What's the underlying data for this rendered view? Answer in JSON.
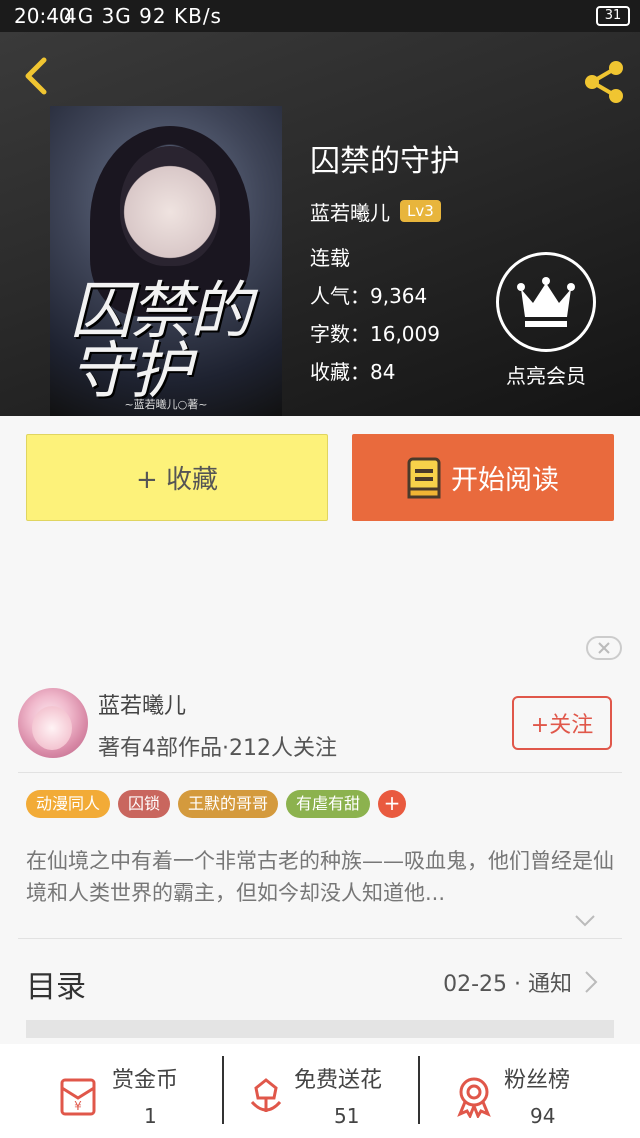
{
  "status_bar": {
    "time": "20:40",
    "network": "4G 3G",
    "speed": "92 KB/s",
    "battery": "31"
  },
  "book": {
    "title": "囚禁的守护",
    "author": "蓝若曦儿",
    "level": "Lv3",
    "status": "连载",
    "popularity": "人气：9,364",
    "word_count": "字数：16,009",
    "favorites": "收藏：84",
    "cover_title": "囚禁的守护",
    "cover_author": "~蓝若曦儿○著~"
  },
  "vip": {
    "label": "点亮会员"
  },
  "actions": {
    "collect_label": "+ 收藏",
    "read_label": "开始阅读"
  },
  "author_card": {
    "name": "蓝若曦儿",
    "summary": "著有4部作品·212人关注",
    "follow_label": "+关注"
  },
  "tags": [
    {
      "label": "动漫同人",
      "color": "#f2ab37"
    },
    {
      "label": "囚锁",
      "color": "#c9665e"
    },
    {
      "label": "王默的哥哥",
      "color": "#d49a3d"
    },
    {
      "label": "有虐有甜",
      "color": "#8cb24e"
    }
  ],
  "tag_add": "+",
  "description": "在仙境之中有着一个非常古老的种族——吸血鬼，他们曾经是仙境和人类世界的霸主，但如今却没人知道他...",
  "toc": {
    "title": "目录",
    "notice": "02-25 · 通知"
  },
  "bottom_bar": {
    "reward": {
      "label": "赏金币",
      "value": "1"
    },
    "flowers": {
      "label": "免费送花",
      "value": "51"
    },
    "fans": {
      "label": "粉丝榜",
      "value": "94"
    }
  },
  "colors": {
    "accent_orange": "#e96a3d",
    "collect_yellow": "#fdf27a",
    "level_badge": "#e8b53c",
    "follow_red": "#e0574a"
  }
}
